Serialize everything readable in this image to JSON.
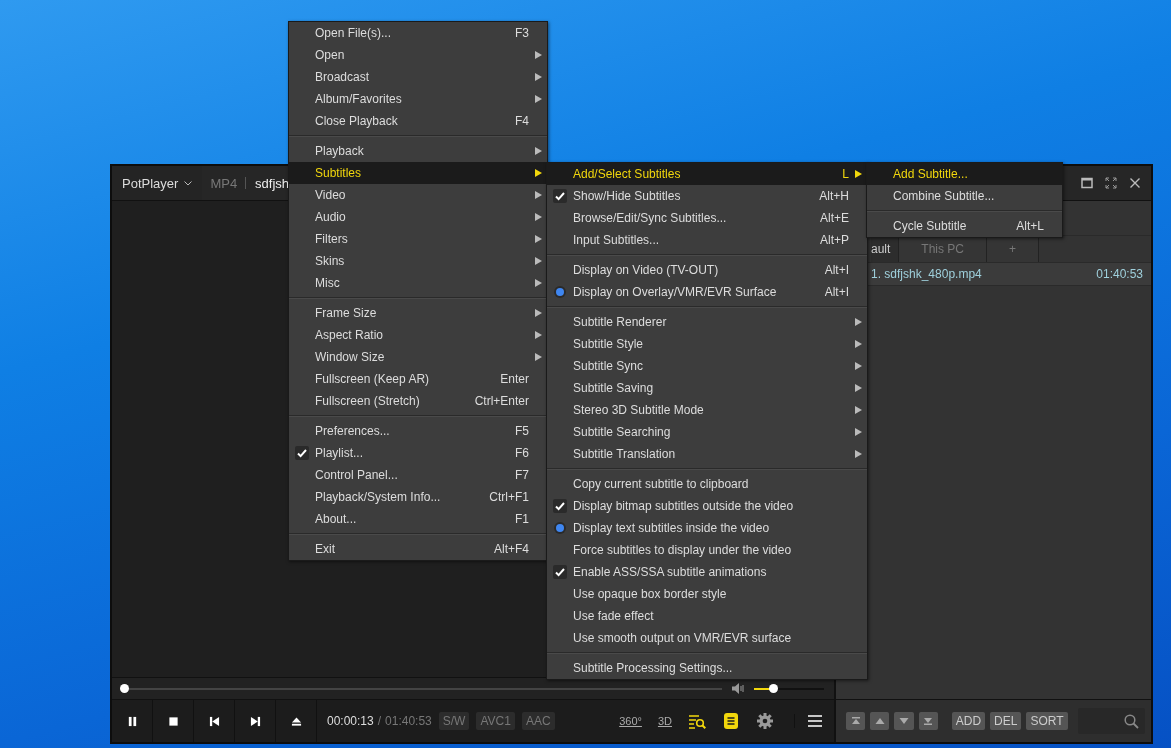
{
  "window": {
    "app_menu": "PotPlayer",
    "format": "MP4",
    "title": "sdfjsh"
  },
  "player": {
    "seek": {
      "level": 0.005
    },
    "volume": {
      "level": 0.28
    },
    "time": "00:00:13",
    "time_separator": "/",
    "duration": "01:40:53",
    "badges": [
      "S/W",
      "AVC1",
      "AAC"
    ],
    "toggles": [
      "360°",
      "3D"
    ]
  },
  "playlist": {
    "tabs": [
      {
        "label": "ault",
        "selected": true
      },
      {
        "label": "This PC",
        "selected": false
      },
      {
        "label": "+",
        "selected": false
      }
    ],
    "items": [
      {
        "name": "1. sdfjshk_480p.mp4",
        "duration": "01:40:53"
      }
    ],
    "buttons": [
      "ADD",
      "DEL",
      "SORT"
    ]
  },
  "menus": [
    {
      "items": [
        {
          "kind": "item",
          "label": "Open File(s)...",
          "shortcut": "F3",
          "submenu": false,
          "selected": false
        },
        {
          "kind": "item",
          "label": "Open",
          "submenu": true,
          "selected": false
        },
        {
          "kind": "item",
          "label": "Broadcast",
          "submenu": true,
          "selected": false
        },
        {
          "kind": "item",
          "label": "Album/Favorites",
          "submenu": true,
          "selected": false
        },
        {
          "kind": "item",
          "label": "Close Playback",
          "shortcut": "F4",
          "submenu": false,
          "selected": false
        },
        {
          "kind": "separator"
        },
        {
          "kind": "item",
          "label": "Playback",
          "submenu": true,
          "selected": false
        },
        {
          "kind": "item",
          "label": "Subtitles",
          "submenu": true,
          "selected": true
        },
        {
          "kind": "item",
          "label": "Video",
          "submenu": true,
          "selected": false
        },
        {
          "kind": "item",
          "label": "Audio",
          "submenu": true,
          "selected": false
        },
        {
          "kind": "item",
          "label": "Filters",
          "submenu": true,
          "selected": false
        },
        {
          "kind": "item",
          "label": "Skins",
          "submenu": true,
          "selected": false
        },
        {
          "kind": "item",
          "label": "Misc",
          "submenu": true,
          "selected": false
        },
        {
          "kind": "separator"
        },
        {
          "kind": "item",
          "label": "Frame Size",
          "submenu": true,
          "selected": false
        },
        {
          "kind": "item",
          "label": "Aspect Ratio",
          "submenu": true,
          "selected": false
        },
        {
          "kind": "item",
          "label": "Window Size",
          "submenu": true,
          "selected": false
        },
        {
          "kind": "item",
          "label": "Fullscreen (Keep AR)",
          "shortcut": "Enter",
          "submenu": false,
          "selected": false
        },
        {
          "kind": "item",
          "label": "Fullscreen (Stretch)",
          "shortcut": "Ctrl+Enter",
          "submenu": false,
          "selected": false
        },
        {
          "kind": "separator"
        },
        {
          "kind": "item",
          "label": "Preferences...",
          "shortcut": "F5",
          "submenu": false,
          "selected": false
        },
        {
          "kind": "check",
          "label": "Playlist...",
          "shortcut": "F6",
          "submenu": false,
          "checked": true,
          "selected": false
        },
        {
          "kind": "item",
          "label": "Control Panel...",
          "shortcut": "F7",
          "submenu": false,
          "selected": false
        },
        {
          "kind": "item",
          "label": "Playback/System Info...",
          "shortcut": "Ctrl+F1",
          "submenu": false,
          "selected": false
        },
        {
          "kind": "item",
          "label": "About...",
          "shortcut": "F1",
          "submenu": false,
          "selected": false
        },
        {
          "kind": "separator"
        },
        {
          "kind": "item",
          "label": "Exit",
          "shortcut": "Alt+F4",
          "submenu": false,
          "selected": false
        }
      ]
    },
    {
      "items": [
        {
          "kind": "item",
          "label": "Add/Select Subtitles",
          "shortcut": "L",
          "submenu": true,
          "selected": true
        },
        {
          "kind": "check",
          "label": "Show/Hide Subtitles",
          "shortcut": "Alt+H",
          "submenu": false,
          "checked": true,
          "selected": false
        },
        {
          "kind": "item",
          "label": "Browse/Edit/Sync Subtitles...",
          "shortcut": "Alt+E",
          "submenu": false,
          "selected": false
        },
        {
          "kind": "item",
          "label": "Input Subtitles...",
          "shortcut": "Alt+P",
          "submenu": false,
          "selected": false
        },
        {
          "kind": "separator"
        },
        {
          "kind": "radio",
          "label": "Display on Video (TV-OUT)",
          "shortcut": "Alt+I",
          "submenu": false,
          "checked": false,
          "selected": false
        },
        {
          "kind": "radio",
          "label": "Display on Overlay/VMR/EVR Surface",
          "shortcut": "Alt+I",
          "submenu": false,
          "checked": true,
          "selected": false
        },
        {
          "kind": "separator"
        },
        {
          "kind": "item",
          "label": "Subtitle Renderer",
          "submenu": true,
          "selected": false
        },
        {
          "kind": "item",
          "label": "Subtitle Style",
          "submenu": true,
          "selected": false
        },
        {
          "kind": "item",
          "label": "Subtitle Sync",
          "submenu": true,
          "selected": false
        },
        {
          "kind": "item",
          "label": "Subtitle Saving",
          "submenu": true,
          "selected": false
        },
        {
          "kind": "item",
          "label": "Stereo 3D Subtitle Mode",
          "submenu": true,
          "selected": false
        },
        {
          "kind": "item",
          "label": "Subtitle Searching",
          "submenu": true,
          "selected": false
        },
        {
          "kind": "item",
          "label": "Subtitle Translation",
          "submenu": true,
          "selected": false
        },
        {
          "kind": "separator"
        },
        {
          "kind": "item",
          "label": "Copy current subtitle to clipboard",
          "submenu": false,
          "selected": false
        },
        {
          "kind": "check",
          "label": "Display bitmap subtitles outside the video",
          "submenu": false,
          "checked": true,
          "selected": false
        },
        {
          "kind": "radio",
          "label": "Display text subtitles inside the video",
          "submenu": false,
          "checked": true,
          "selected": false
        },
        {
          "kind": "radio",
          "label": "Force subtitles to display under the video",
          "submenu": false,
          "checked": false,
          "selected": false
        },
        {
          "kind": "check",
          "label": "Enable ASS/SSA subtitle animations",
          "submenu": false,
          "checked": true,
          "selected": false
        },
        {
          "kind": "check",
          "label": "Use opaque box border style",
          "submenu": false,
          "checked": false,
          "selected": false
        },
        {
          "kind": "check",
          "label": "Use fade effect",
          "submenu": false,
          "checked": false,
          "selected": false
        },
        {
          "kind": "check",
          "label": "Use smooth output on VMR/EVR surface",
          "submenu": false,
          "checked": false,
          "selected": false
        },
        {
          "kind": "separator"
        },
        {
          "kind": "item",
          "label": "Subtitle Processing Settings...",
          "submenu": false,
          "selected": false
        }
      ]
    },
    {
      "items": [
        {
          "kind": "item",
          "label": "Add Subtitle...",
          "submenu": false,
          "selected": true
        },
        {
          "kind": "item",
          "label": "Combine Subtitle...",
          "submenu": false,
          "selected": false
        },
        {
          "kind": "separator"
        },
        {
          "kind": "item",
          "label": "Cycle Subtitle",
          "shortcut": "Alt+L",
          "submenu": false,
          "selected": false
        }
      ]
    }
  ]
}
